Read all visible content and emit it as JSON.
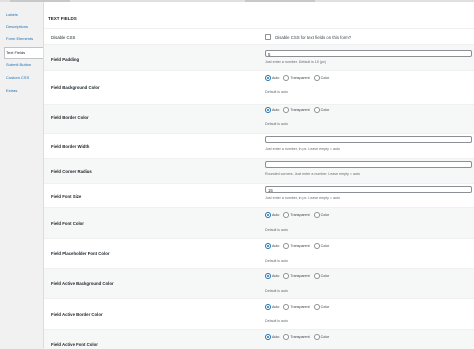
{
  "tabs": [
    {
      "label": "Labels",
      "active": false
    },
    {
      "label": "Descriptions",
      "active": false
    },
    {
      "label": "Form Elements",
      "active": false
    },
    {
      "label": "Text Fields",
      "active": true
    },
    {
      "label": "Submit Button",
      "active": false
    },
    {
      "label": "Custom CSS",
      "active": false
    },
    {
      "label": "Extras",
      "active": false
    }
  ],
  "section_title": "TEXT FIELDS",
  "disable_css": {
    "label": "Disable CSS",
    "checkbox_label": "Disable CSS for text fields on this form?",
    "checked": false
  },
  "field_padding": {
    "label": "Field Padding",
    "value": "5",
    "desc": "Just enter a number. Default is 15 (px)"
  },
  "field_bg_color": {
    "label": "Field Background Color",
    "desc": "Default is auto"
  },
  "field_border_color": {
    "label": "Field Border Color",
    "desc": "Default is auto"
  },
  "field_border_width": {
    "label": "Field Border Width",
    "value": "",
    "desc": "Just enter a number, in px. Leave empty = auto"
  },
  "field_corner_radius": {
    "label": "Field Corner Radius",
    "value": "",
    "desc": "Rounded corners. Just enter a number. Leave empty = auto"
  },
  "field_font_size": {
    "label": "Field Font Size",
    "value": "15",
    "desc": "Just enter a number, in px. Leave empty = auto"
  },
  "field_font_color": {
    "label": "Field Font Color",
    "desc": "Default is auto"
  },
  "field_placeholder_font_color": {
    "label": "Field Placeholder Font Color",
    "desc": "Default is auto"
  },
  "field_active_bg_color": {
    "label": "Field Active Background Color",
    "desc": "Default is auto"
  },
  "field_active_border_color": {
    "label": "Field Active Border Color",
    "desc": "Default is auto"
  },
  "field_active_font_color": {
    "label": "Field Active Font Color",
    "desc": "Default is auto"
  },
  "radio_options": {
    "auto": "Auto",
    "transparent": "Transparent",
    "color": "Color",
    "selected": "Auto"
  }
}
